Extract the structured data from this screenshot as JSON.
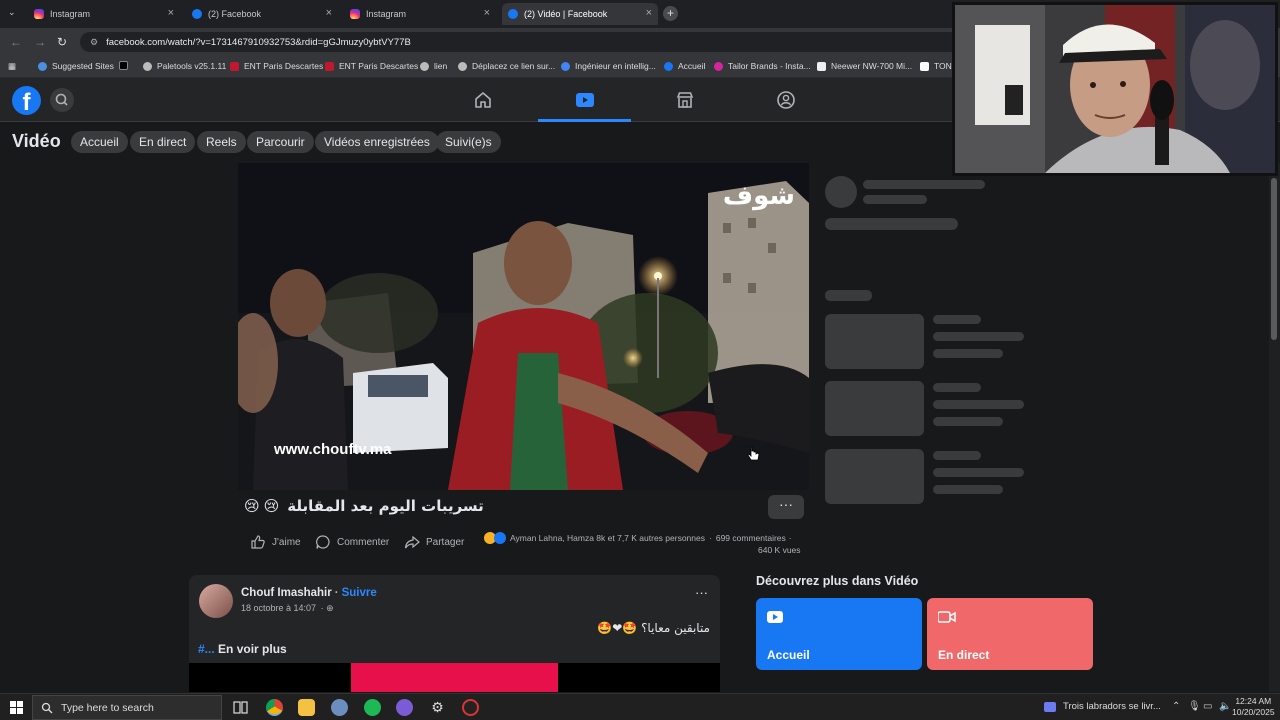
{
  "browser": {
    "tabs": [
      {
        "title": "Instagram",
        "icon": "instagram-icon"
      },
      {
        "title": "(2) Facebook",
        "icon": "facebook-icon"
      },
      {
        "title": "Instagram",
        "icon": "instagram-icon"
      },
      {
        "title": "(2) Vidéo | Facebook",
        "icon": "facebook-icon",
        "active": true
      }
    ],
    "url": "facebook.com/watch/?v=1731467910932753&rdid=gGJmuzy0ybtVY77B",
    "bookmarks": [
      {
        "label": "Suggested Sites"
      },
      {
        "label": ""
      },
      {
        "label": "Paletools v25.1.11"
      },
      {
        "label": "ENT Paris Descartes"
      },
      {
        "label": "ENT Paris Descartes"
      },
      {
        "label": "lien"
      },
      {
        "label": "Déplacez ce lien sur..."
      },
      {
        "label": "Ingénieur en intellig..."
      },
      {
        "label": "Accueil"
      },
      {
        "label": "Tailor Brands - Insta..."
      },
      {
        "label": "Neewer NW-700 Mi..."
      },
      {
        "label": "TON"
      }
    ]
  },
  "fb": {
    "logo": "f",
    "subnav_title": "Vidéo",
    "pills": [
      "Accueil",
      "En direct",
      "Reels",
      "Parcourir",
      "Vidéos enregistrées",
      "Suivi(e)s"
    ]
  },
  "post": {
    "watermark_ar": "شوف",
    "watermark_url": "www.chouftv.ma",
    "title": "تسريبات اليوم بعد المقابلة",
    "title_emoji": "😢",
    "actions": {
      "like": "J'aime",
      "comment": "Commenter",
      "share": "Partager"
    },
    "reactions_text": "Ayman Lahna, Hamza 8k et 7,7 K autres personnes",
    "comments": "699 commentaires",
    "views": "640 K vues",
    "more": "···"
  },
  "second_post": {
    "author": "Chouf Imashahir",
    "follow": "Suivre",
    "time": "18 octobre à 14:07",
    "text": "متابقين معايا؟",
    "text_emoji": "🤩❤🤩",
    "see_more_hash": "#...",
    "see_more": "En voir plus",
    "more": "···"
  },
  "discover": {
    "title": "Découvrez plus dans Vidéo",
    "cards": [
      {
        "label": "Accueil",
        "color": "#1877f2"
      },
      {
        "label": "En direct",
        "color": "#f0686a"
      }
    ]
  },
  "taskbar": {
    "search_placeholder": "Type here to search",
    "news": "Trois labradors se livr...",
    "time": "12:24 AM",
    "date": "10/20/2025"
  },
  "colors": {
    "accent": "#2d88ff",
    "fb_blue": "#1877f2",
    "bg": "#18191a",
    "card": "#242526"
  }
}
